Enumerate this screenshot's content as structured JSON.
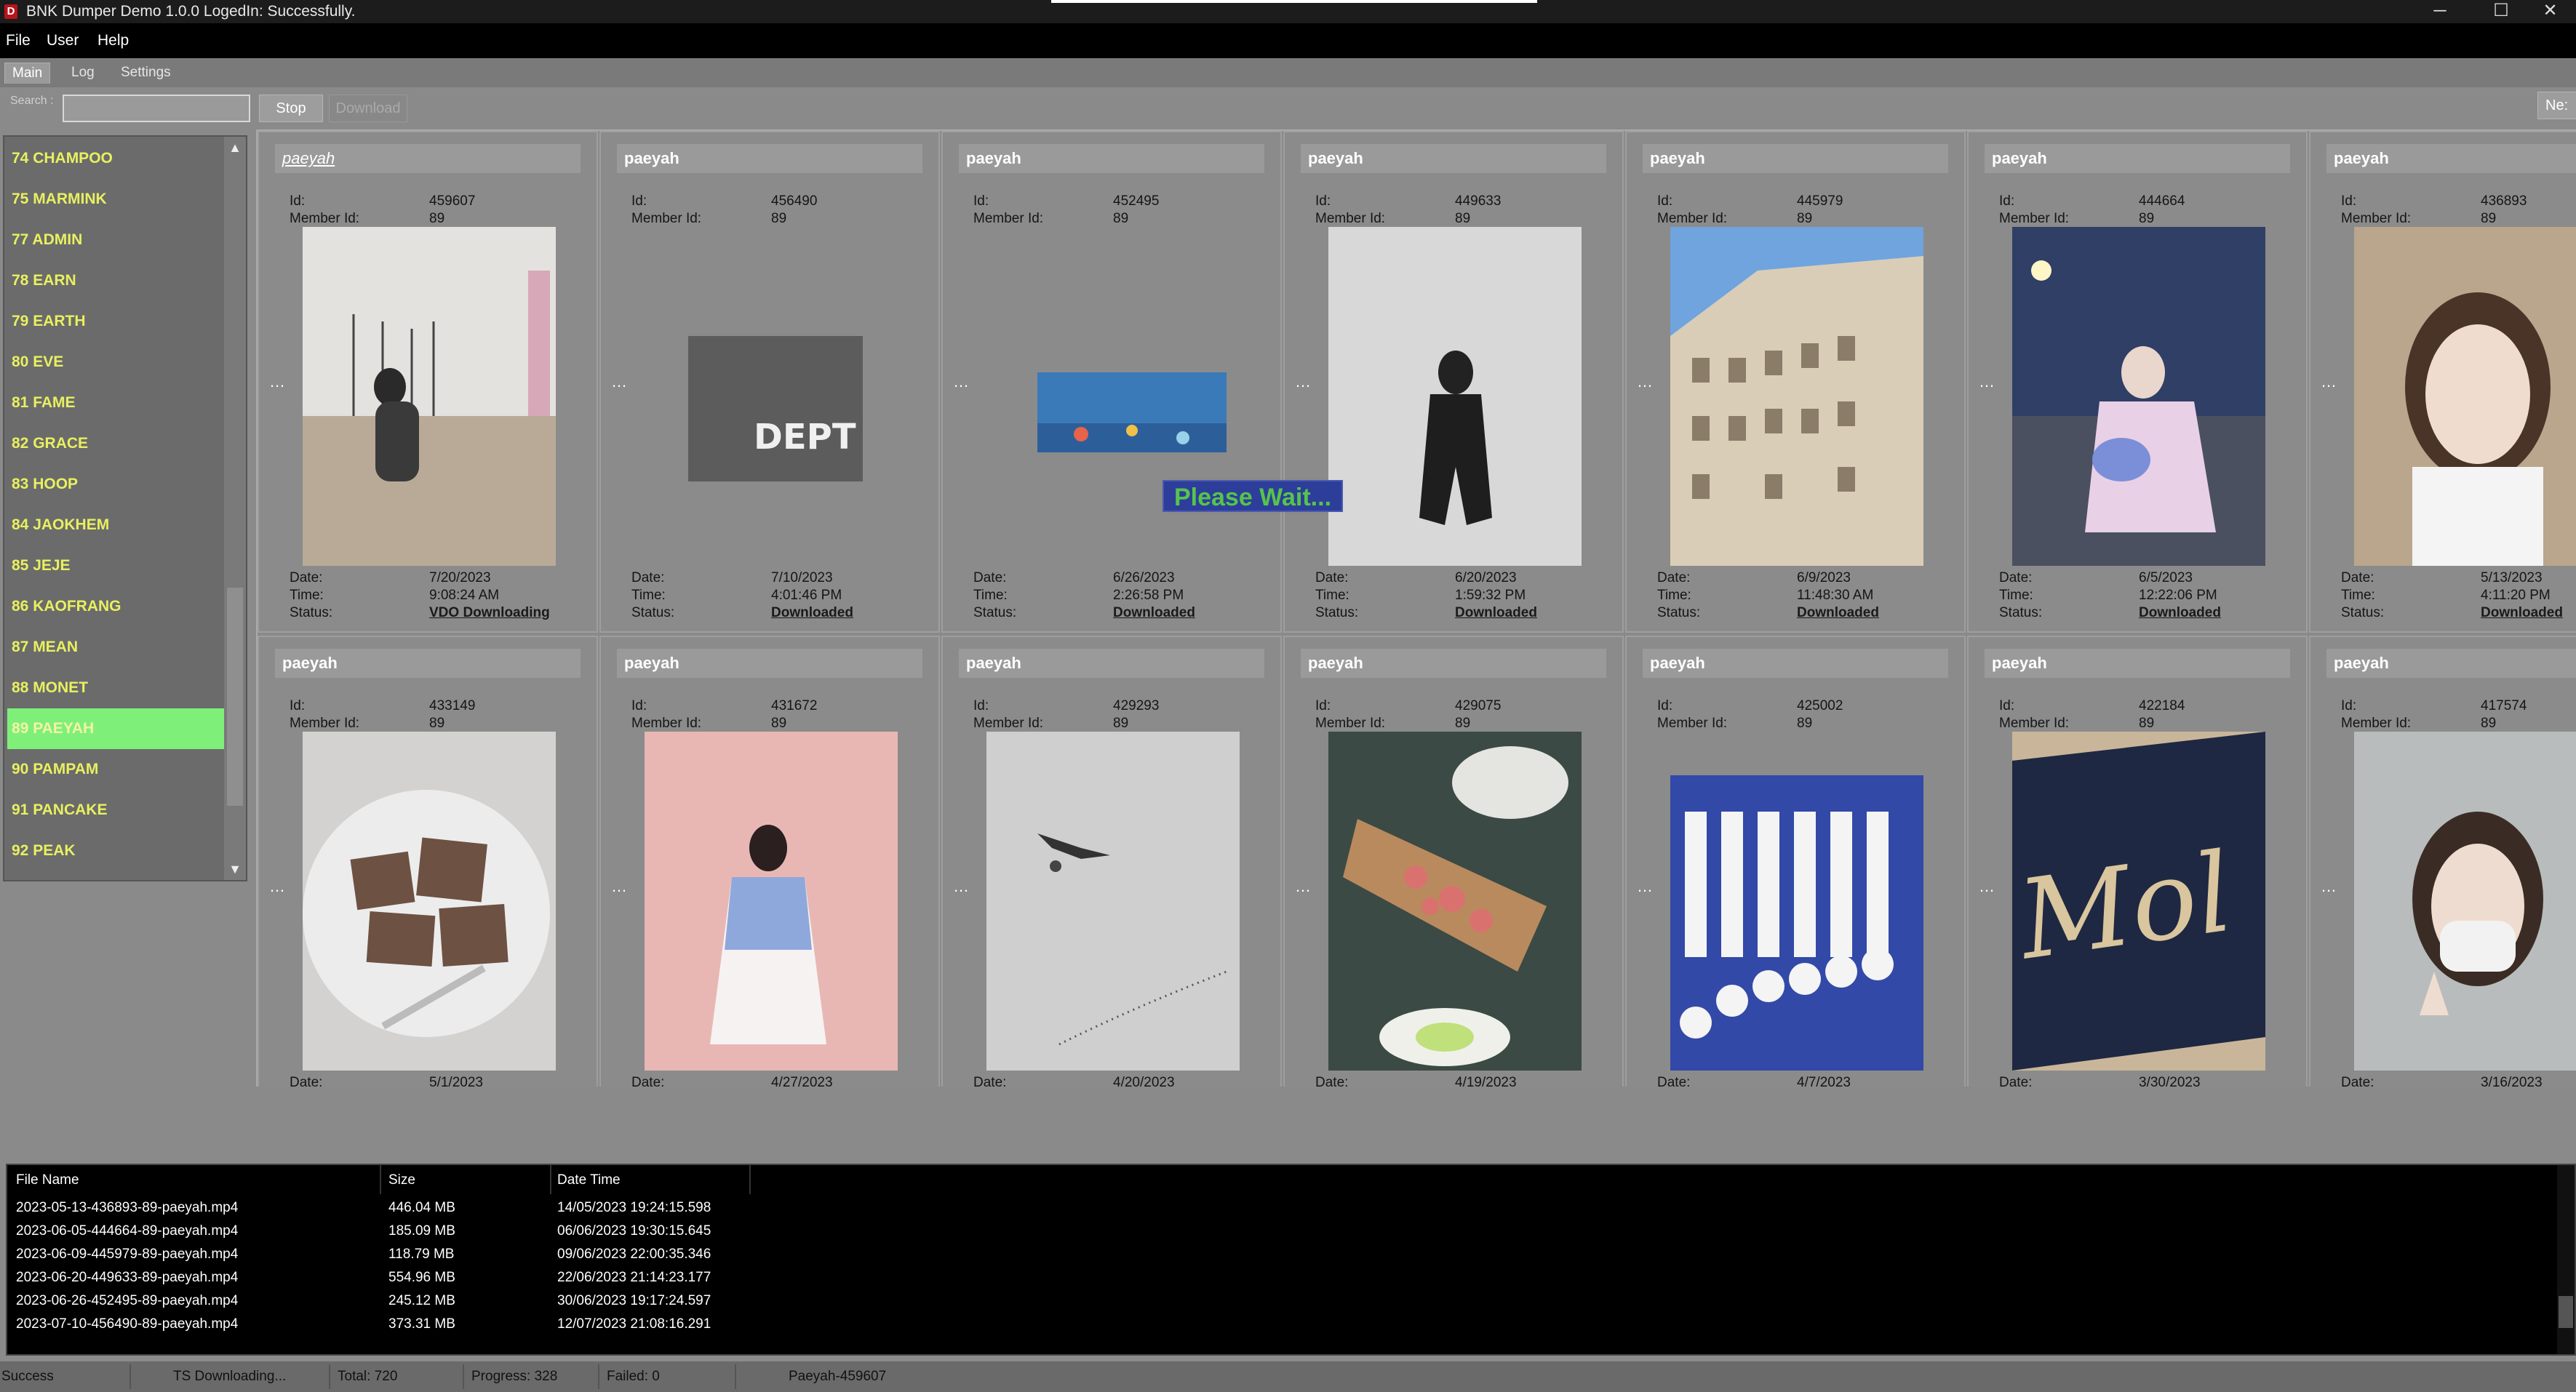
{
  "window": {
    "title": "BNK Dumper Demo 1.0.0 LogedIn: Successfully.",
    "controls": {
      "minimize": "─",
      "maximize": "☐",
      "close": "✕"
    }
  },
  "menu": {
    "file": "File",
    "user": "User",
    "help": "Help"
  },
  "tabs": {
    "main": "Main",
    "log": "Log",
    "settings": "Settings"
  },
  "search": {
    "label": "Search :",
    "value": ""
  },
  "toolbar": {
    "stop": "Stop",
    "download": "Download",
    "next": "Ne:"
  },
  "members": [
    {
      "label": "74 CHAMPOO"
    },
    {
      "label": "75 MARMINK"
    },
    {
      "label": "77 ADMIN"
    },
    {
      "label": "78 EARN"
    },
    {
      "label": "79 EARTH"
    },
    {
      "label": "80 EVE"
    },
    {
      "label": "81 FAME"
    },
    {
      "label": "82 GRACE"
    },
    {
      "label": "83 HOOP"
    },
    {
      "label": "84 JAOKHEM"
    },
    {
      "label": "85 JEJE"
    },
    {
      "label": "86 KAOFRANG"
    },
    {
      "label": "87 MEAN"
    },
    {
      "label": "88 MONET"
    },
    {
      "label": "89 PAEYAH"
    },
    {
      "label": "90 PAMPAM"
    },
    {
      "label": "91 PANCAKE"
    },
    {
      "label": "92 PEAK"
    }
  ],
  "labels": {
    "id": "Id:",
    "member_id": "Member Id:",
    "date": "Date:",
    "time": "Time:",
    "status": "Status:",
    "dots": "…"
  },
  "cards_row1": [
    {
      "name": "paeyah",
      "id": "459607",
      "member_id": "89",
      "date": "7/20/2023",
      "time": "9:08:24 AM",
      "status": "VDO Downloading"
    },
    {
      "name": "paeyah",
      "id": "456490",
      "member_id": "89",
      "date": "7/10/2023",
      "time": "4:01:46 PM",
      "status": "Downloaded"
    },
    {
      "name": "paeyah",
      "id": "452495",
      "member_id": "89",
      "date": "6/26/2023",
      "time": "2:26:58 PM",
      "status": "Downloaded"
    },
    {
      "name": "paeyah",
      "id": "449633",
      "member_id": "89",
      "date": "6/20/2023",
      "time": "1:59:32 PM",
      "status": "Downloaded"
    },
    {
      "name": "paeyah",
      "id": "445979",
      "member_id": "89",
      "date": "6/9/2023",
      "time": "11:48:30 AM",
      "status": "Downloaded"
    },
    {
      "name": "paeyah",
      "id": "444664",
      "member_id": "89",
      "date": "6/5/2023",
      "time": "12:22:06 PM",
      "status": "Downloaded"
    },
    {
      "name": "paeyah",
      "id": "436893",
      "member_id": "89",
      "date": "5/13/2023",
      "time": "4:11:20 PM",
      "status": "Downloaded"
    }
  ],
  "cards_row2": [
    {
      "name": "paeyah",
      "id": "433149",
      "member_id": "89",
      "date": "5/1/2023"
    },
    {
      "name": "paeyah",
      "id": "431672",
      "member_id": "89",
      "date": "4/27/2023"
    },
    {
      "name": "paeyah",
      "id": "429293",
      "member_id": "89",
      "date": "4/20/2023"
    },
    {
      "name": "paeyah",
      "id": "429075",
      "member_id": "89",
      "date": "4/19/2023"
    },
    {
      "name": "paeyah",
      "id": "425002",
      "member_id": "89",
      "date": "4/7/2023"
    },
    {
      "name": "paeyah",
      "id": "422184",
      "member_id": "89",
      "date": "3/30/2023"
    },
    {
      "name": "paeyah",
      "id": "417574",
      "member_id": "89",
      "date": "3/16/2023"
    }
  ],
  "overlay": {
    "text": "Please Wait..."
  },
  "files": {
    "columns": [
      "File Name",
      "Size",
      "Date Time"
    ],
    "rows": [
      {
        "name": "2023-05-13-436893-89-paeyah.mp4",
        "size": "446.04 MB",
        "datetime": "14/05/2023 19:24:15.598"
      },
      {
        "name": "2023-06-05-444664-89-paeyah.mp4",
        "size": "185.09 MB",
        "datetime": "06/06/2023 19:30:15.645"
      },
      {
        "name": "2023-06-09-445979-89-paeyah.mp4",
        "size": "118.79 MB",
        "datetime": "09/06/2023 22:00:35.346"
      },
      {
        "name": "2023-06-20-449633-89-paeyah.mp4",
        "size": "554.96 MB",
        "datetime": "22/06/2023 21:14:23.177"
      },
      {
        "name": "2023-06-26-452495-89-paeyah.mp4",
        "size": "245.12 MB",
        "datetime": "30/06/2023 19:17:24.597"
      },
      {
        "name": "2023-07-10-456490-89-paeyah.mp4",
        "size": "373.31 MB",
        "datetime": "12/07/2023 21:08:16.291"
      }
    ]
  },
  "status": {
    "state": "Success",
    "task": "TS Downloading...",
    "total": "Total: 720",
    "progress": "Progress: 328",
    "failed": "Failed: 0",
    "current": "Paeyah-459607"
  },
  "colors": {
    "selected_member": "#7ef07a",
    "member_text": "#e8f060",
    "overlay_bg": "#2d3e9a",
    "overlay_text": "#56c44c"
  }
}
